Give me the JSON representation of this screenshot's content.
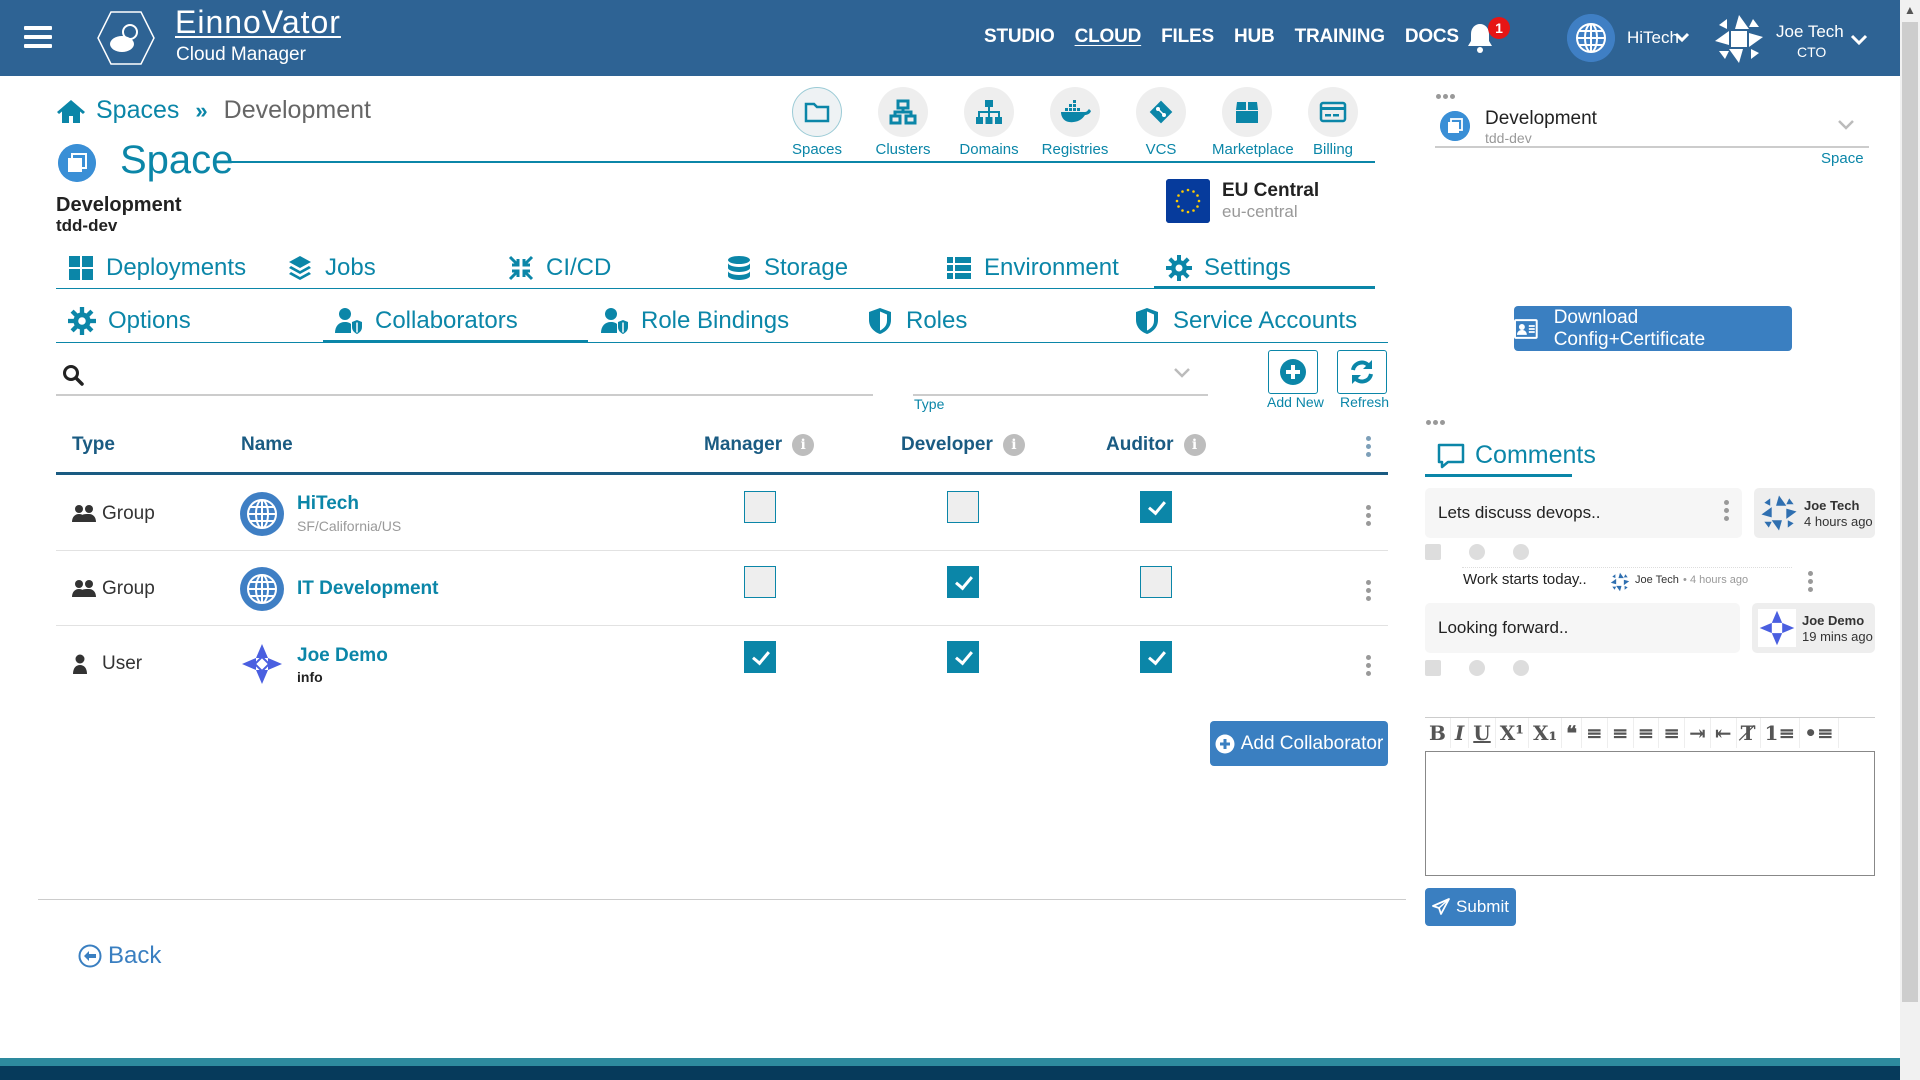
{
  "header": {
    "brand_name": "EinnoVator",
    "brand_subtitle": "Cloud Manager",
    "nav": [
      {
        "label": "STUDIO",
        "active": false
      },
      {
        "label": "CLOUD",
        "active": true
      },
      {
        "label": "FILES",
        "active": false
      },
      {
        "label": "HUB",
        "active": false
      },
      {
        "label": "TRAINING",
        "active": false
      },
      {
        "label": "DOCS",
        "active": false
      }
    ],
    "notifications_count": "1",
    "organization": "HiTech",
    "user": {
      "name": "Joe Tech",
      "role": "CTO"
    }
  },
  "breadcrumb": {
    "root": "Spaces",
    "separator": "»",
    "current": "Development"
  },
  "page": {
    "title": "Space",
    "space_name": "Development",
    "space_id": "tdd-dev"
  },
  "shortcuts": [
    {
      "label": "Spaces",
      "icon": "folder-icon",
      "selected": true
    },
    {
      "label": "Clusters",
      "icon": "sitemap-icon"
    },
    {
      "label": "Domains",
      "icon": "network-icon"
    },
    {
      "label": "Registries",
      "icon": "docker-icon"
    },
    {
      "label": "VCS",
      "icon": "git-icon"
    },
    {
      "label": "Marketplace",
      "icon": "box-icon"
    },
    {
      "label": "Billing",
      "icon": "credit-card-icon"
    }
  ],
  "region": {
    "name": "EU Central",
    "id": "eu-central"
  },
  "tabs_primary": [
    {
      "label": "Deployments",
      "icon": "grid-icon"
    },
    {
      "label": "Jobs",
      "icon": "layers-icon"
    },
    {
      "label": "CI/CD",
      "icon": "compress-icon"
    },
    {
      "label": "Storage",
      "icon": "database-icon"
    },
    {
      "label": "Environment",
      "icon": "list-icon"
    },
    {
      "label": "Settings",
      "icon": "gear-icon",
      "active": true
    }
  ],
  "tabs_secondary": [
    {
      "label": "Options",
      "icon": "gear-icon"
    },
    {
      "label": "Collaborators",
      "icon": "user-shield-icon",
      "active": true
    },
    {
      "label": "Role Bindings",
      "icon": "user-shield-icon"
    },
    {
      "label": "Roles",
      "icon": "shield-icon"
    },
    {
      "label": "Service Accounts",
      "icon": "shield-icon"
    }
  ],
  "filters": {
    "search_value": "",
    "search_placeholder": "",
    "type_label": "Type",
    "type_value": "",
    "add_new_label": "Add New",
    "refresh_label": "Refresh"
  },
  "table": {
    "columns": [
      "Type",
      "Name",
      "Manager",
      "Developer",
      "Auditor"
    ],
    "rows": [
      {
        "type": "Group",
        "type_icon": "users-icon",
        "name": "HiTech",
        "subtitle": "SF/California/US",
        "manager": false,
        "developer": false,
        "auditor": true
      },
      {
        "type": "Group",
        "type_icon": "users-icon",
        "name": "IT Development",
        "subtitle": "",
        "manager": false,
        "developer": true,
        "auditor": false
      },
      {
        "type": "User",
        "type_icon": "user-icon",
        "name": "Joe Demo",
        "subtitle": "info",
        "manager": true,
        "developer": true,
        "auditor": true
      }
    ]
  },
  "actions": {
    "add_collaborator": "Add Collaborator",
    "back": "Back"
  },
  "side_panel": {
    "context": {
      "title": "Development",
      "subtitle": "tdd-dev",
      "label": "Space"
    },
    "download_label": "Download Config+Certificate",
    "comments_title": "Comments",
    "comments": [
      {
        "text": "Lets discuss devops..",
        "author": "Joe Tech",
        "time": "4 hours ago",
        "replies": [
          {
            "text": "Work starts today..",
            "author": "Joe Tech",
            "separator": "•",
            "time": "4 hours ago"
          }
        ]
      },
      {
        "text": "Looking forward..",
        "author": "Joe Demo",
        "time": "19 mins ago",
        "replies": []
      }
    ],
    "editor_tools": [
      "B",
      "I",
      "U",
      "X¹",
      "X₁",
      "❝",
      "≡",
      "≡",
      "≡",
      "≡",
      "⇥",
      "⇤",
      "T̸",
      "1≡",
      "•≡"
    ],
    "editor_value": "",
    "submit_label": "Submit"
  },
  "colors": {
    "header_bg": "#2e6394",
    "accent": "#0b86a8",
    "button_blue": "#3a7fc1",
    "badge_red": "#e61515"
  }
}
